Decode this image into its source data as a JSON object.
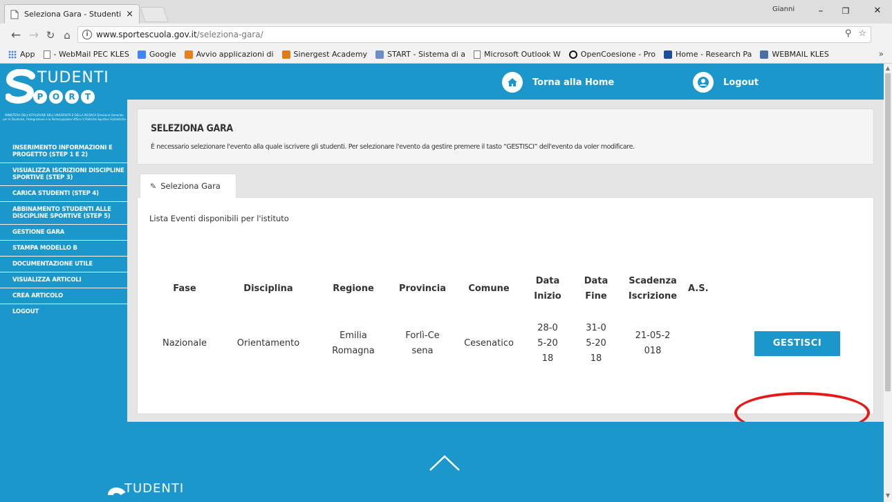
{
  "browser": {
    "tab_title": "Seleziona Gara - Studenti",
    "tab_close": "×",
    "profile": "Gianni",
    "window": {
      "minimize": "–",
      "restore": "❐",
      "close": "✕"
    },
    "url_host": "www.sportescuola.gov.it",
    "url_path": "/seleziona-gara/",
    "bookmarks": [
      {
        "label": "App",
        "icon": "apps-grid-icon",
        "color": "#4285f4"
      },
      {
        "label": "- WebMail PEC KLES",
        "icon": "page-icon",
        "color": "#777777"
      },
      {
        "label": "Google",
        "icon": "google-icon",
        "color": "#4285f4"
      },
      {
        "label": "Avvio applicazioni di",
        "icon": "app-launch-icon",
        "color": "#e67e22"
      },
      {
        "label": "Sinergest Academy",
        "icon": "sinergest-icon",
        "color": "#e07b1a"
      },
      {
        "label": "START - Sistema di a",
        "icon": "start-icon",
        "color": "#6c8fc7"
      },
      {
        "label": "Microsoft Outlook W",
        "icon": "page-icon",
        "color": "#777777"
      },
      {
        "label": "OpenCoesione - Pro",
        "icon": "opencoesione-icon",
        "color": "#111111"
      },
      {
        "label": "Home - Research Pa",
        "icon": "research-icon",
        "color": "#1f4e99"
      },
      {
        "label": "WEBMAIL KLES",
        "icon": "webmail-icon",
        "color": "#4a6fa5"
      }
    ],
    "bookmarks_more": "»"
  },
  "site": {
    "logo_studenti": "TUDENTI",
    "logo_sport_letters": [
      "P",
      "O",
      "R",
      "T"
    ],
    "ministry_text": "MINISTERO DELL'ISTRUZIONE DELL'UNIVERSITÀ E DELLA RICERCA Direzione Generale per lo Studente, l'Integrazione e la Partecipazione Ufficio V Politiche Sportive Scolastiche",
    "nav": {
      "home": "Torna alla Home",
      "logout": "Logout"
    },
    "sidebar": [
      "INSERIMENTO INFORMAZIONI E PROGETTO (STEP 1 E 2)",
      "VISUALIZZA ISCRIZIONI DISCIPLINE SPORTIVE (STEP 3)",
      "CARICA STUDENTI (STEP 4)",
      "ABBINAMENTO STUDENTI ALLE DISCIPLINE SPORTIVE (STEP 5)",
      "GESTIONE GARA",
      "STAMPA MODELLO B",
      "DOCUMENTAZIONE UTILE",
      "VISUALIZZA ARTICOLI",
      "CREA ARTICOLO",
      "LOGOUT"
    ],
    "brand_color": "#1b97cc"
  },
  "main": {
    "title": "SELEZIONA GARA",
    "description": "È necessario selezionare l'evento alla quale iscrivere gli studenti. Per selezionare l'evento da gestire premere il tasto “GESTISCI” dell'evento da voler modificare.",
    "tab_label": "Seleziona Gara",
    "list_title": "Lista Eventi disponibili per l'istituto",
    "table": {
      "headers": [
        "Fase",
        "Disciplina",
        "Regione",
        "Provincia",
        "Comune",
        "Data Inizio",
        "Data Fine",
        "Scadenza Iscrizione",
        "A.S."
      ],
      "rows": [
        {
          "fase": "Nazionale",
          "disciplina": "Orientamento",
          "regione": "Emilia Romagna",
          "provincia": "Forlì-Cesena",
          "comune": "Cesenatico",
          "data_inizio": "28-05-2018",
          "data_fine": "31-05-2018",
          "scadenza": "21-05-2018",
          "as": "",
          "button": "GESTISCI"
        }
      ]
    }
  },
  "footer": {
    "logo_studenti": "TUDENTI"
  }
}
